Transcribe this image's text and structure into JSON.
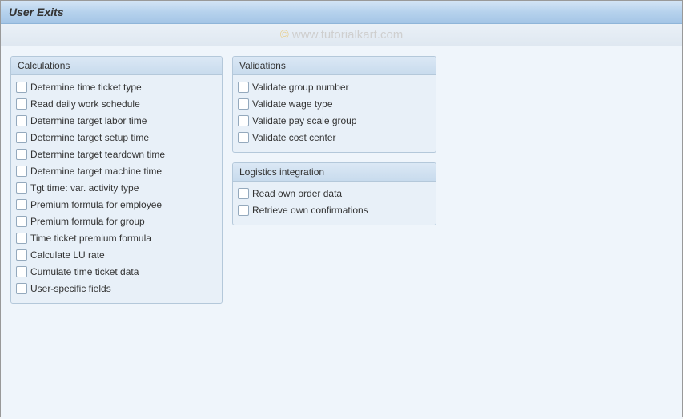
{
  "header": {
    "title": "User Exits"
  },
  "watermark": {
    "copy": "©",
    "text": "www.tutorialkart.com"
  },
  "groups": {
    "calculations": {
      "title": "Calculations",
      "items": [
        "Determine time ticket type",
        "Read daily work schedule",
        "Determine target labor time",
        "Determine target setup time",
        "Determine target teardown time",
        "Determine target machine time",
        "Tgt time: var. activity type",
        "Premium formula for employee",
        "Premium formula for group",
        "Time ticket premium formula",
        "Calculate LU rate",
        "Cumulate time ticket data",
        "User-specific fields"
      ]
    },
    "validations": {
      "title": "Validations",
      "items": [
        "Validate group number",
        "Validate wage type",
        "Validate pay scale group",
        "Validate cost center"
      ]
    },
    "logistics": {
      "title": "Logistics integration",
      "items": [
        "Read own order data",
        "Retrieve own confirmations"
      ]
    }
  }
}
